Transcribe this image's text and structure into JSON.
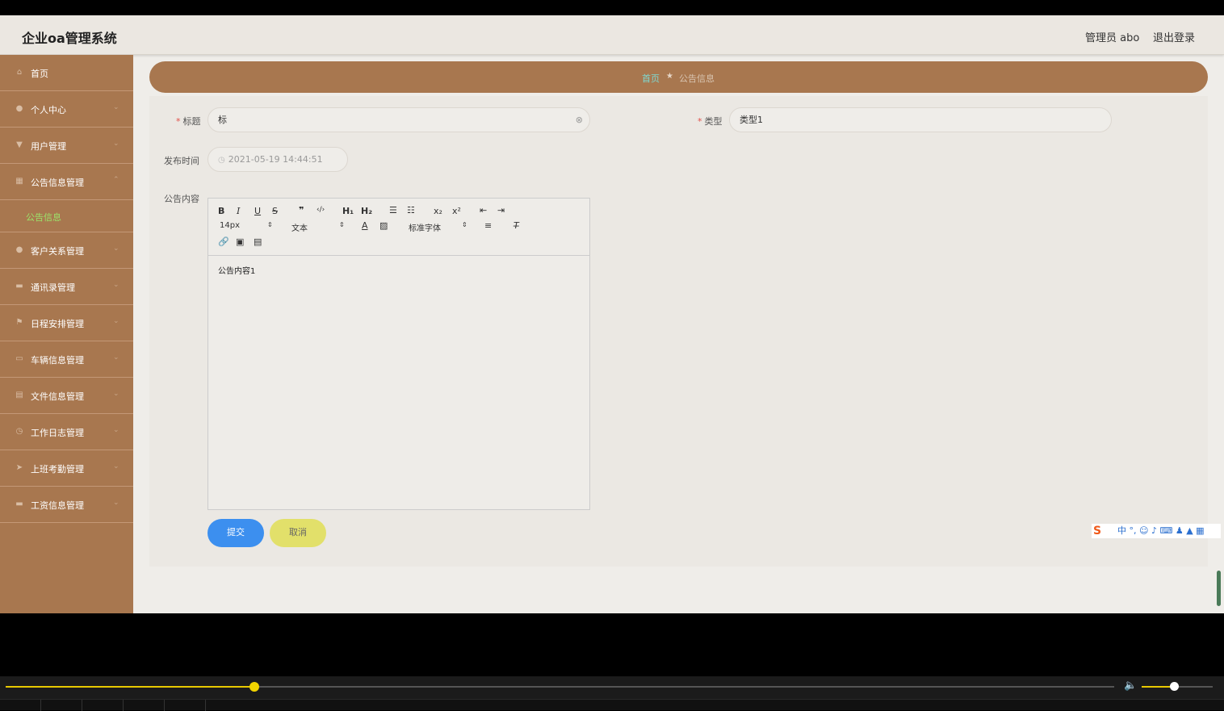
{
  "header": {
    "app_title": "企业oa管理系统",
    "user_label": "管理员 abo",
    "logout_label": "退出登录"
  },
  "sidebar": {
    "items": [
      {
        "label": "首页",
        "icon": "home-icon"
      },
      {
        "label": "个人中心",
        "icon": "user-icon"
      },
      {
        "label": "用户管理",
        "icon": "users-icon"
      },
      {
        "label": "公告信息管理",
        "icon": "grid-icon"
      },
      {
        "label": "客户关系管理",
        "icon": "person-icon"
      },
      {
        "label": "通讯录管理",
        "icon": "contacts-icon"
      },
      {
        "label": "日程安排管理",
        "icon": "flag-icon"
      },
      {
        "label": "车辆信息管理",
        "icon": "car-icon"
      },
      {
        "label": "文件信息管理",
        "icon": "file-icon"
      },
      {
        "label": "工作日志管理",
        "icon": "clock-icon"
      },
      {
        "label": "上班考勤管理",
        "icon": "send-icon"
      },
      {
        "label": "工资信息管理",
        "icon": "money-icon"
      }
    ],
    "sub_item": "公告信息"
  },
  "breadcrumb": {
    "home": "首页",
    "current": "公告信息"
  },
  "form": {
    "title_label": "标题",
    "title_value": "标",
    "type_label": "类型",
    "type_value": "类型1",
    "time_label": "发布时间",
    "time_value": "2021-05-19 14:44:51",
    "content_label": "公告内容"
  },
  "editor": {
    "font_size": "14px",
    "header_select": "文本",
    "font_family": "标准字体",
    "content": "公告内容1"
  },
  "buttons": {
    "submit": "提交",
    "cancel": "取消"
  },
  "ime": {
    "label": "中"
  },
  "player": {
    "progress": 0.224,
    "volume": 0.45
  }
}
